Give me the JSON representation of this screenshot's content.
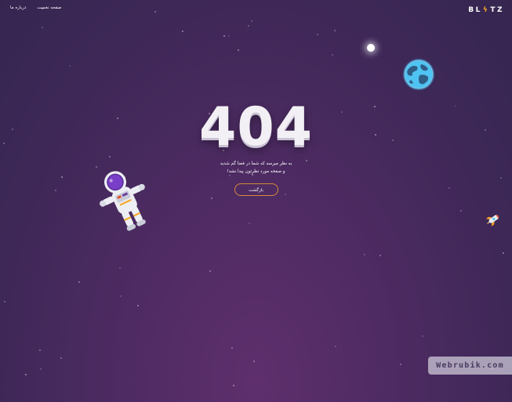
{
  "nav": {
    "home_label": "صفحه نخست",
    "about_label": "درباره ما"
  },
  "brand": {
    "logo_part1": "BL",
    "logo_bolt": "ϟ",
    "logo_part2": "TZ"
  },
  "error": {
    "code": "404",
    "line1": "به نظر میرسه که شما در فضا گم شدید",
    "line2": "و صفحه مورد نظرتون پیدا نشد!",
    "back_label": "بازگشت"
  },
  "illustrations": {
    "astronaut": "astronaut-icon",
    "planet": "earth-icon",
    "moon": "moon-icon",
    "rocket": "rocket-icon"
  },
  "watermark": {
    "text": "Webrubik.com"
  },
  "colors": {
    "background_top": "#352650",
    "background_bottom": "#5e2f6c",
    "button_border": "#d58a3a",
    "logo_accent": "#f5a623"
  }
}
